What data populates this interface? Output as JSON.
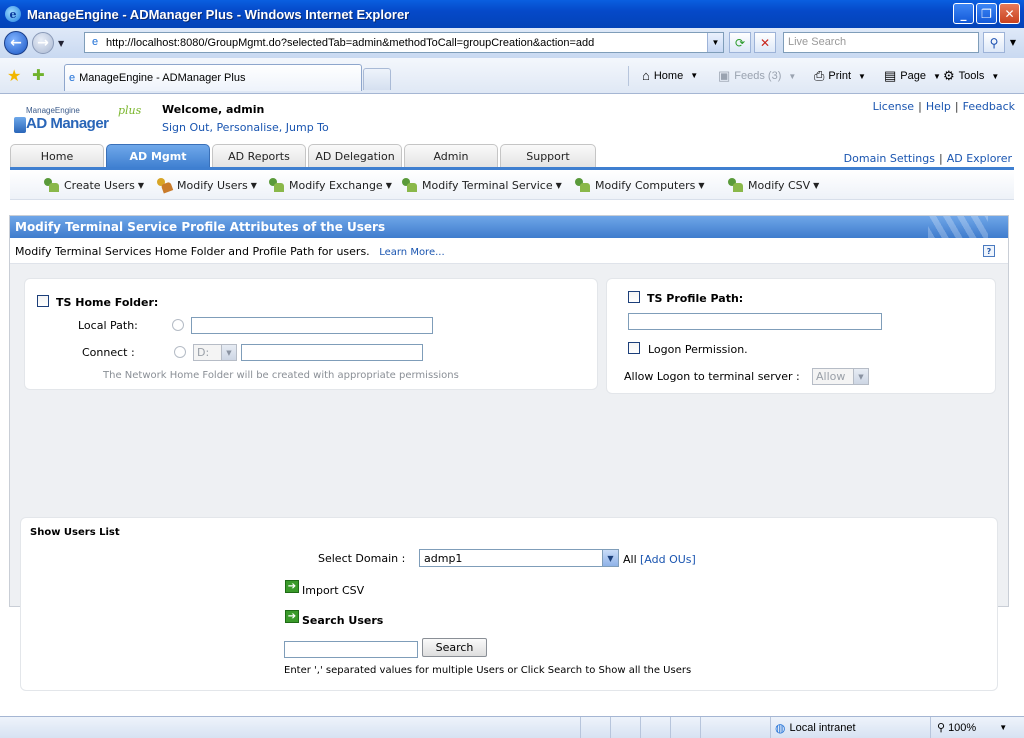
{
  "window": {
    "title": "ManageEngine - ADManager Plus - Windows Internet Explorer"
  },
  "browser": {
    "url": "http://localhost:8080/GroupMgmt.do?selectedTab=admin&methodToCall=groupCreation&action=add",
    "search_placeholder": "Live Search",
    "tab_title": "ManageEngine - ADManager Plus",
    "commands": {
      "home": "Home",
      "feeds": "Feeds (3)",
      "print": "Print",
      "page": "Page",
      "tools": "Tools"
    }
  },
  "header": {
    "logo_top": "ManageEngine",
    "logo_main": "AD Manager",
    "logo_plus": "plus",
    "welcome": "Welcome,  admin",
    "user_links": [
      "Sign Out",
      "Personalise",
      "Jump To"
    ],
    "top_links": [
      "License",
      "Help",
      "Feedback"
    ],
    "domain_links": [
      "Domain Settings",
      "AD Explorer"
    ]
  },
  "tabs": [
    {
      "label": "Home",
      "active": false
    },
    {
      "label": "AD Mgmt",
      "active": true
    },
    {
      "label": "AD Reports",
      "active": false
    },
    {
      "label": "AD Delegation",
      "active": false
    },
    {
      "label": "Admin",
      "active": false
    },
    {
      "label": "Support",
      "active": false
    }
  ],
  "submenu": [
    "Create Users",
    "Modify Users",
    "Modify Exchange",
    "Modify Terminal Service",
    "Modify Computers",
    "Modify CSV"
  ],
  "panel": {
    "title": "Modify Terminal Service Profile Attributes of the Users",
    "description": "Modify Terminal Services Home Folder and Profile Path for users.",
    "learn_more": "Learn More...",
    "help": "?"
  },
  "home_folder": {
    "label": "TS Home Folder:",
    "local_path_label": "Local Path:",
    "connect_label": "Connect :",
    "drive_value": "D:",
    "note": "The Network Home Folder will be created with appropriate permissions"
  },
  "profile": {
    "label": "TS Profile Path:",
    "logon_permission": "Logon Permission.",
    "allow_logon_label": "Allow Logon to terminal server :",
    "allow_value": "Allow"
  },
  "users_list": {
    "title": "Show Users List",
    "select_domain_label": "Select Domain :",
    "domain_value": "admp1",
    "all_label": "All",
    "add_ous": "[Add OUs]",
    "import_csv": "Import CSV",
    "search_users": "Search Users",
    "search_button": "Search",
    "hint": "Enter ',' separated values for multiple Users or Click Search to Show all the Users"
  },
  "status": {
    "zone": "Local intranet",
    "zoom": "100%"
  }
}
